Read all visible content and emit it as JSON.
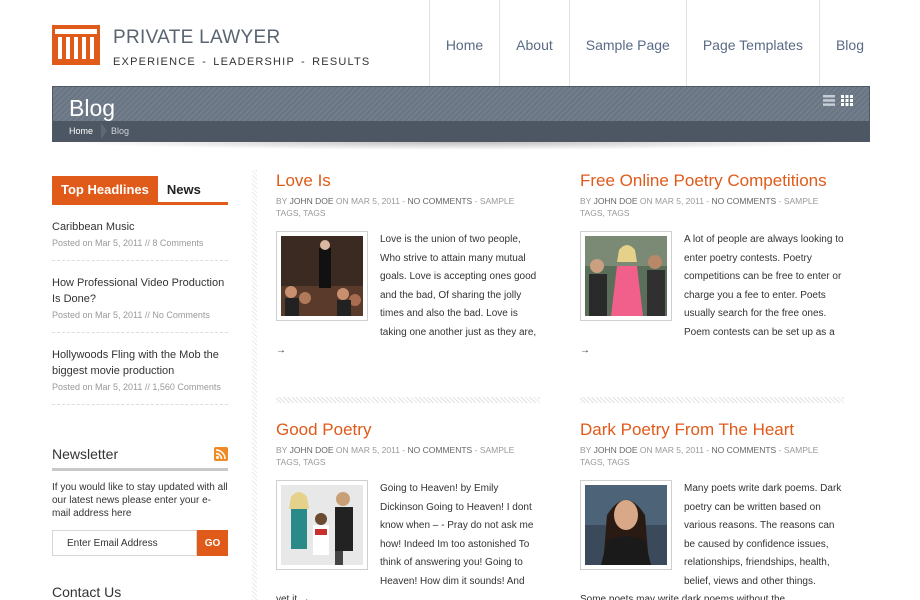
{
  "site": {
    "title": "PRIVATE LAWYER",
    "tagline": "EXPERIENCE  -  LEADERSHIP  -  RESULTS",
    "accent": "#e05a1a"
  },
  "nav": [
    {
      "label": "Home"
    },
    {
      "label": "About"
    },
    {
      "label": "Sample Page"
    },
    {
      "label": "Page Templates"
    },
    {
      "label": "Blog"
    }
  ],
  "banner": {
    "title": "Blog",
    "breadcrumb_home": "Home",
    "breadcrumb_current": "Blog",
    "icons": [
      "list-view-icon",
      "grid-view-icon"
    ]
  },
  "sidebar": {
    "tabs": [
      {
        "label": "Top Headlines",
        "active": true
      },
      {
        "label": "News",
        "active": false
      }
    ],
    "headlines": [
      {
        "title": "Caribbean Music",
        "meta": "Posted on Mar 5, 2011 // 8 Comments"
      },
      {
        "title": "How Professional Video Production Is Done?",
        "meta": "Posted on Mar 5, 2011 // No Comments"
      },
      {
        "title": "Hollywoods Fling with the Mob the biggest movie production",
        "meta": "Posted on Mar 5, 2011 // 1,560 Comments"
      }
    ],
    "newsletter": {
      "heading": "Newsletter",
      "text": "If you would like to stay updated with all our latest news please enter your e-mail address here",
      "placeholder": "Enter Email Address",
      "button": "GO"
    },
    "contact_heading": "Contact Us"
  },
  "posts": [
    {
      "title": "Love Is",
      "by": "BY",
      "author": "JOHN DOE",
      "on": "ON MAR 5, 2011 -",
      "comments": "NO COMMENTS",
      "tags_sep": "-",
      "tags": "SAMPLE TAGS, TAGS",
      "excerpt": "Love is the union of two people, Who strive to attain many mutual goals. Love is accepting ones good and the bad, Of sharing the jolly times and also the bad. Love is taking one another just as they are,",
      "arrow": "→"
    },
    {
      "title": "Free Online Poetry Competitions",
      "by": "BY",
      "author": "JOHN DOE",
      "on": "ON MAR 5, 2011 -",
      "comments": "NO COMMENTS",
      "tags_sep": "-",
      "tags": "SAMPLE TAGS, TAGS",
      "excerpt": "A lot of people are always looking to enter poetry contests. Poetry competitions can be free to enter or charge you a fee to enter. Poets usually search for the free ones. Poem contests can be set up as a",
      "arrow": "→"
    },
    {
      "title": "Good Poetry",
      "by": "BY",
      "author": "JOHN DOE",
      "on": "ON MAR 5, 2011 -",
      "comments": "NO COMMENTS",
      "tags_sep": "-",
      "tags": "SAMPLE TAGS, TAGS",
      "excerpt": "Going to Heaven! by Emily Dickinson Going to Heaven! I dont know when – - Pray do not ask me how! Indeed Im too astonished To think of answering you! Going to Heaven! How dim it sounds! And yet it",
      "arrow": "→"
    },
    {
      "title": "Dark Poetry From The Heart",
      "by": "BY",
      "author": "JOHN DOE",
      "on": "ON MAR 5, 2011 -",
      "comments": "NO COMMENTS",
      "tags_sep": "-",
      "tags": "SAMPLE TAGS, TAGS",
      "excerpt": "Many poets write dark poems. Dark poetry can be written based on various reasons. The reasons can be caused by confidence issues, relationships, friendships, health, belief, views and other things. Some poets may write dark poems without the",
      "arrow": ""
    }
  ]
}
